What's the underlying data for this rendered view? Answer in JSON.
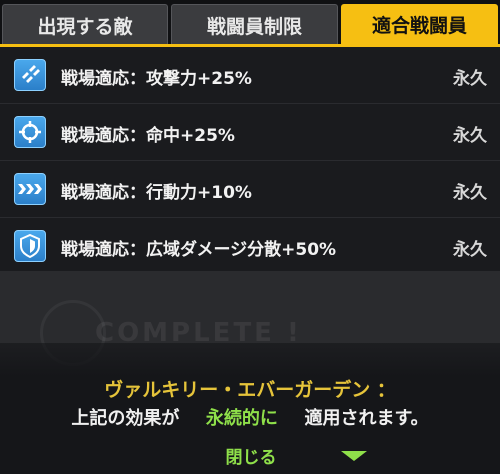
{
  "tabs": [
    {
      "label": "出現する敵",
      "active": false
    },
    {
      "label": "戦闘員制限",
      "active": false
    },
    {
      "label": "適合戦闘員",
      "active": true
    }
  ],
  "effects": [
    {
      "icon": "attack-up-icon",
      "label": "戦場適応：攻撃力+25%",
      "duration": "永久"
    },
    {
      "icon": "accuracy-up-icon",
      "label": "戦場適応：命中+25%",
      "duration": "永久"
    },
    {
      "icon": "speed-up-icon",
      "label": "戦場適応：行動力+10%",
      "duration": "永久"
    },
    {
      "icon": "damage-spread-icon",
      "label": "戦場適応：広域ダメージ分散+50%",
      "duration": "永久"
    }
  ],
  "message": {
    "character": "ヴァルキリー・エバーガーデン ：",
    "prefix": "上記の効果が",
    "highlight": "永続的に",
    "suffix": "適用されます。"
  },
  "close_label": "閉じる",
  "background_text": "COMPLETE !",
  "colors": {
    "accent": "#f6bf12",
    "green": "#8fe04a",
    "title_gold": "#e6c43a",
    "icon_blue": "#3a94dc"
  }
}
